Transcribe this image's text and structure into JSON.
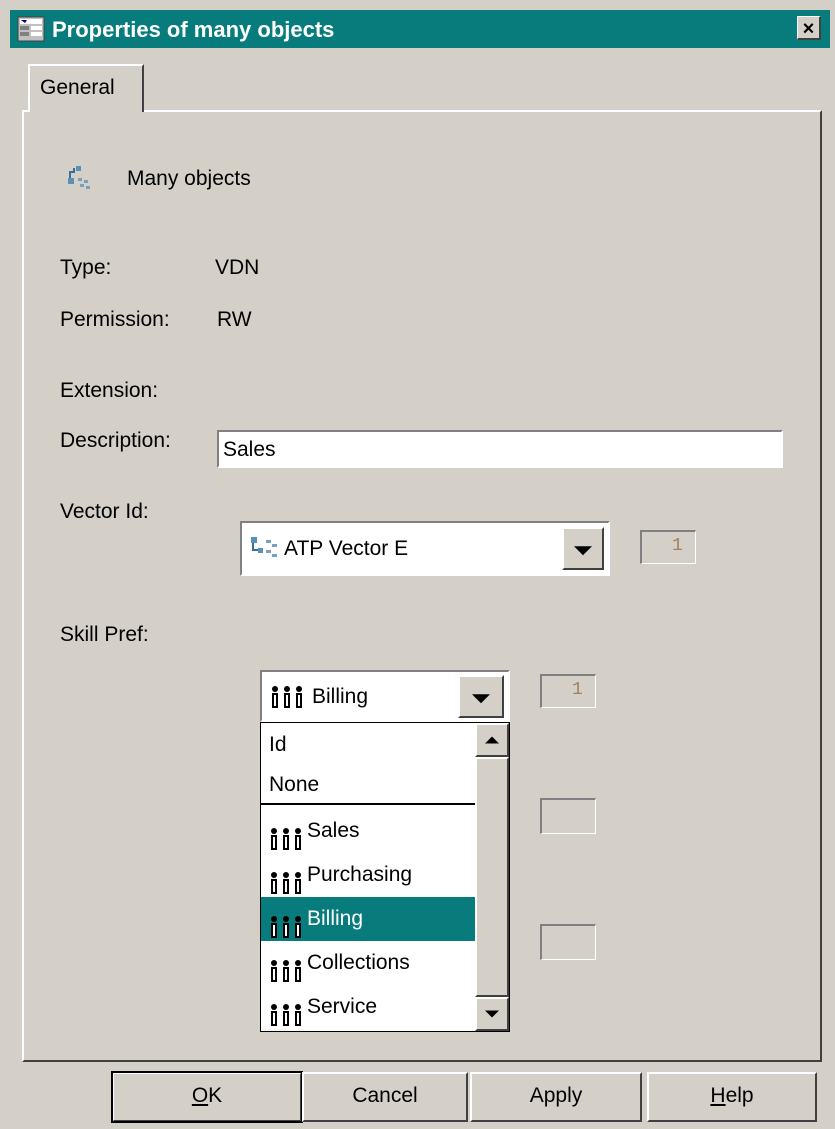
{
  "window": {
    "title": "Properties of many objects",
    "close_symbol": "×"
  },
  "tabs": [
    {
      "label": "General"
    }
  ],
  "header": {
    "title": "Many objects"
  },
  "fields": {
    "type_label": "Type:",
    "type_value": "VDN",
    "permission_label": "Permission:",
    "permission_value": "RW",
    "extension_label": "Extension:",
    "description_label": "Description:",
    "description_value": "Sales",
    "vector_label": "Vector Id:",
    "vector_value": "ATP Vector E",
    "vector_number": "1",
    "skill_label": "Skill Pref:",
    "skill_value": "Billing",
    "skill_number": "1"
  },
  "skill_options": [
    {
      "label": "Id",
      "icon": "none"
    },
    {
      "label": "None",
      "icon": "none"
    },
    {
      "label": "Sales",
      "icon": "people-icon"
    },
    {
      "label": "Purchasing",
      "icon": "people-icon"
    },
    {
      "label": "Billing",
      "icon": "people-icon",
      "selected": true
    },
    {
      "label": "Collections",
      "icon": "people-icon"
    },
    {
      "label": "Service",
      "icon": "people-icon"
    }
  ],
  "buttons": {
    "ok_mnemonic": "O",
    "ok_rest": "K",
    "cancel": "Cancel",
    "apply": "Apply",
    "help_mnemonic": "H",
    "help_rest": "elp"
  },
  "colors": {
    "title_bar": "#087c7c",
    "selection": "#087c7c",
    "face": "#d4d0c8"
  }
}
